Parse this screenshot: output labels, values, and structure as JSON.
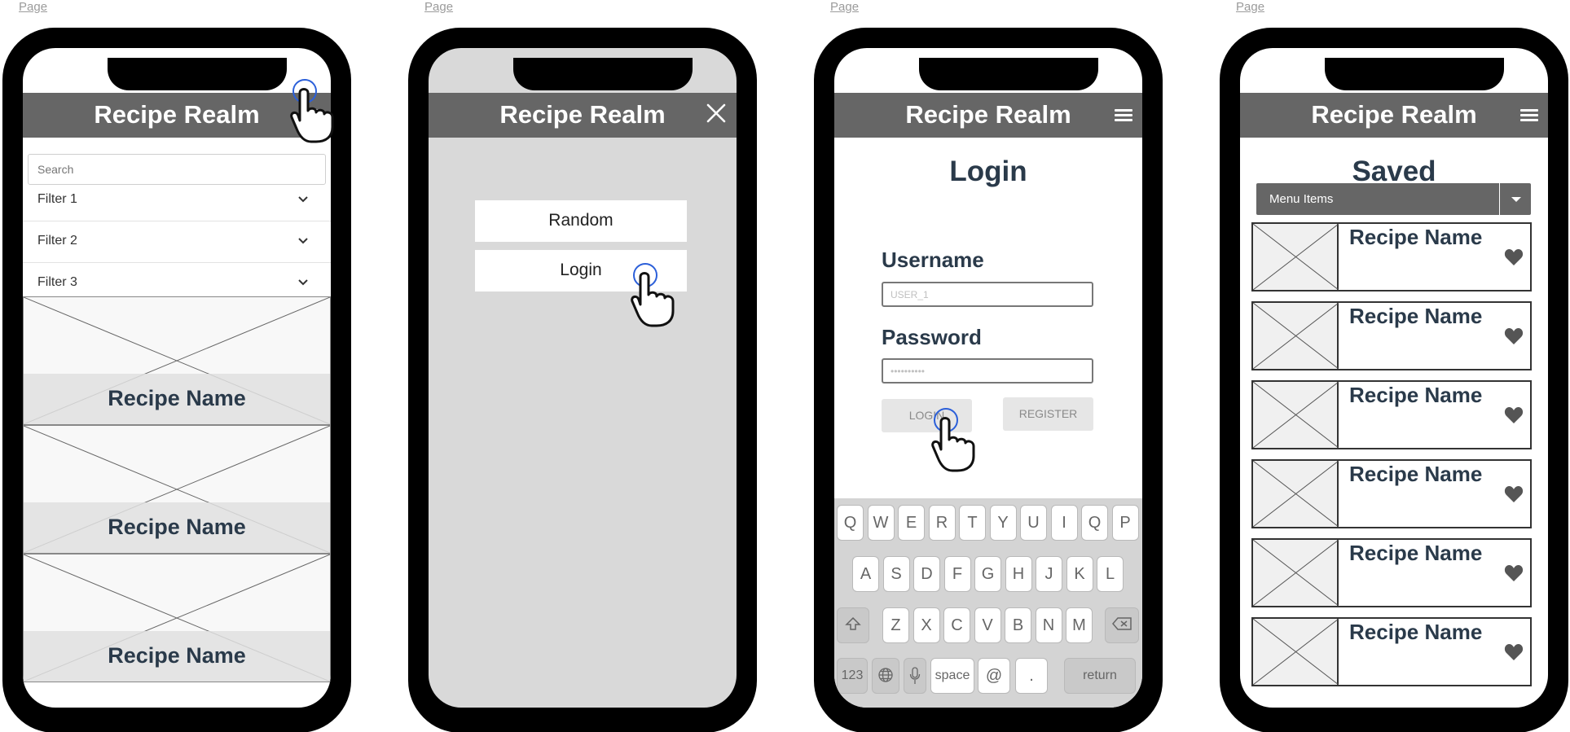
{
  "page_labels": [
    "Page",
    "Page",
    "Page",
    "Page"
  ],
  "app": {
    "title": "Recipe Realm"
  },
  "screen1": {
    "search_placeholder": "Search",
    "filters": [
      "Filter 1",
      "Filter 2",
      "Filter 3"
    ],
    "cards": [
      "Recipe Name",
      "Recipe Name",
      "Recipe Name"
    ]
  },
  "screen2": {
    "menu": [
      "Random",
      "Login"
    ]
  },
  "screen3": {
    "title": "Login",
    "username_label": "Username",
    "username_value": "USER_1",
    "password_label": "Password",
    "password_value": "••••••••••",
    "login_button": "LOGIN",
    "register_button": "REGISTER",
    "keyboard": {
      "row1": [
        "Q",
        "W",
        "E",
        "R",
        "T",
        "Y",
        "U",
        "I",
        "Q",
        "P"
      ],
      "row2": [
        "A",
        "S",
        "D",
        "F",
        "G",
        "H",
        "J",
        "K",
        "L"
      ],
      "row3": [
        "Z",
        "X",
        "C",
        "V",
        "B",
        "N",
        "M"
      ],
      "num": "123",
      "space": "space",
      "at": "@",
      "dot": ".",
      "return": "return"
    }
  },
  "screen4": {
    "title": "Saved",
    "dropdown": "Menu Items",
    "items": [
      "Recipe Name",
      "Recipe Name",
      "Recipe Name",
      "Recipe Name",
      "Recipe Name",
      "Recipe Name"
    ]
  },
  "colors": {
    "header": "#666666",
    "title_text": "#2a3a4a",
    "tap_ring": "#2b5fd9"
  }
}
